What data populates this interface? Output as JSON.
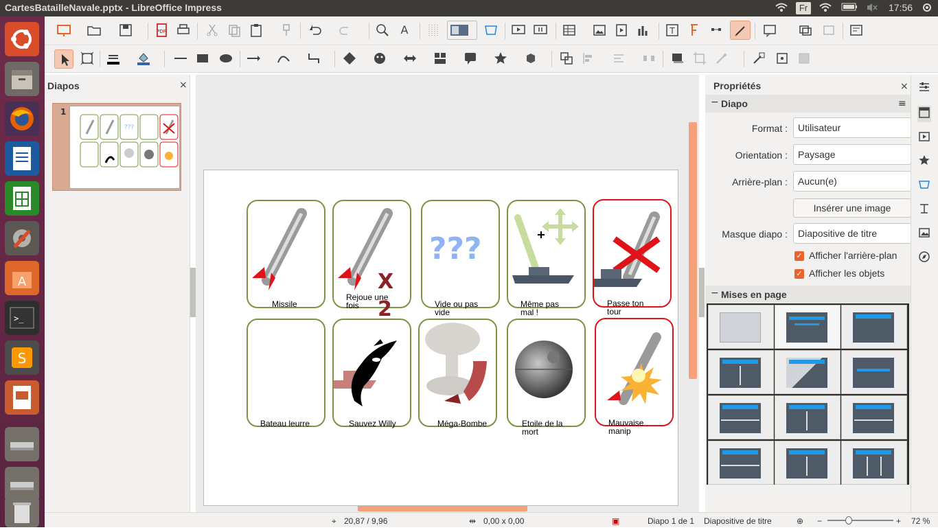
{
  "window": {
    "title": "CartesBatailleNavale.pptx - LibreOffice Impress"
  },
  "tray": {
    "keyboard": "Fr",
    "time": "17:56"
  },
  "launcher": {
    "items": [
      "Ubuntu",
      "Files",
      "Firefox",
      "Writer",
      "Calc",
      "Settings",
      "Software Center",
      "Terminal",
      "Sublime Text",
      "Impress",
      "Drive",
      "Drive",
      "Trash"
    ]
  },
  "slides_panel": {
    "title": "Diapos",
    "close": "×",
    "slide_number": "1"
  },
  "slide": {
    "cards": [
      {
        "label": "Missile",
        "icon": "rocket-icon"
      },
      {
        "label": "Rejoue une fois",
        "icon": "rocket-icon",
        "overlay": "X",
        "overlay2": "2"
      },
      {
        "label": "Vide ou pas vide",
        "icon": "question-icon",
        "overlay": "???"
      },
      {
        "label": "Même pas mal !",
        "icon": "wrench-ship-icon"
      },
      {
        "label": "Passe ton tour",
        "icon": "rocket-cross-icon"
      },
      {
        "label": "Bateau leurre",
        "icon": "empty"
      },
      {
        "label": "Sauvez Willy",
        "icon": "orca-ship-icon"
      },
      {
        "label": "Méga-Bombe",
        "icon": "mushroom-cloud-icon"
      },
      {
        "label": "Etoile de la mort",
        "icon": "death-star-icon"
      },
      {
        "label": "Mauvaise manip",
        "icon": "rocket-explosion-icon"
      }
    ]
  },
  "properties": {
    "title": "Propriétés",
    "close": "×",
    "section_slide": "Diapo",
    "format_label": "Format :",
    "format_value": "Utilisateur",
    "orientation_label": "Orientation :",
    "orientation_value": "Paysage",
    "background_label": "Arrière-plan :",
    "background_value": "Aucun(e)",
    "insert_image": "Insérer une image",
    "master_label": "Masque diapo :",
    "master_value": "Diapositive de titre",
    "show_background": "Afficher l'arrière-plan",
    "show_objects": "Afficher les objets",
    "section_layouts": "Mises en page"
  },
  "status": {
    "position": "20,87 / 9,96",
    "size": "0,00 x 0,00",
    "slide_info": "Diapo 1 de 1",
    "master": "Diapositive de titre",
    "zoom": "72 %"
  }
}
